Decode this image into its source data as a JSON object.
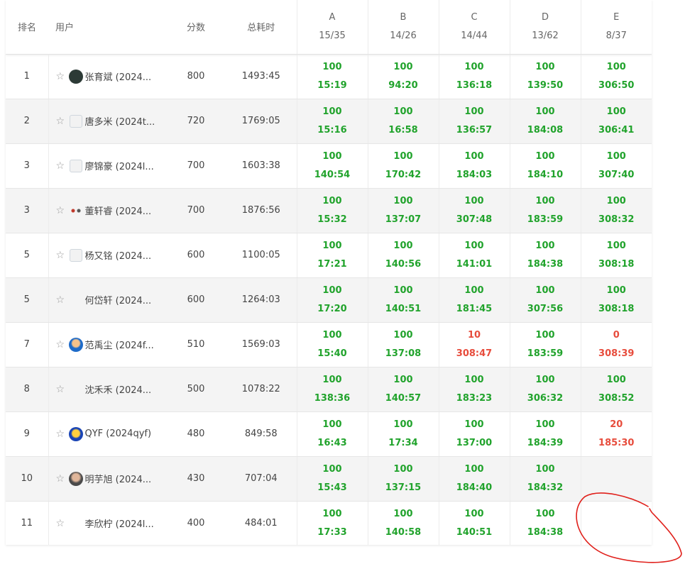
{
  "headers": {
    "rank": "排名",
    "user": "用户",
    "score": "分数",
    "time": "总耗时"
  },
  "problems": [
    {
      "id": "A",
      "stat": "15/35"
    },
    {
      "id": "B",
      "stat": "14/26"
    },
    {
      "id": "C",
      "stat": "14/44"
    },
    {
      "id": "D",
      "stat": "13/62"
    },
    {
      "id": "E",
      "stat": "8/37"
    }
  ],
  "rows": [
    {
      "rank": "1",
      "user": "张育斌 (2024...",
      "avatar": "dark-avatar-icon",
      "score": "800",
      "time": "1493:45",
      "cells": [
        {
          "pts": "100",
          "tm": "15:19",
          "status": "ac"
        },
        {
          "pts": "100",
          "tm": "94:20",
          "status": "ac"
        },
        {
          "pts": "100",
          "tm": "136:18",
          "status": "ac"
        },
        {
          "pts": "100",
          "tm": "139:50",
          "status": "ac"
        },
        {
          "pts": "100",
          "tm": "306:50",
          "status": "ac"
        }
      ]
    },
    {
      "rank": "2",
      "user": "唐多米 (2024t...",
      "avatar": "broken-image-icon",
      "score": "720",
      "time": "1769:05",
      "cells": [
        {
          "pts": "100",
          "tm": "15:16",
          "status": "ac"
        },
        {
          "pts": "100",
          "tm": "16:58",
          "status": "ac"
        },
        {
          "pts": "100",
          "tm": "136:57",
          "status": "ac"
        },
        {
          "pts": "100",
          "tm": "184:08",
          "status": "ac"
        },
        {
          "pts": "100",
          "tm": "306:41",
          "status": "ac"
        }
      ]
    },
    {
      "rank": "3",
      "user": "廖锦豪 (2024l...",
      "avatar": "broken-image-icon",
      "score": "700",
      "time": "1603:38",
      "cells": [
        {
          "pts": "100",
          "tm": "140:54",
          "status": "ac"
        },
        {
          "pts": "100",
          "tm": "170:42",
          "status": "ac"
        },
        {
          "pts": "100",
          "tm": "184:03",
          "status": "ac"
        },
        {
          "pts": "100",
          "tm": "184:10",
          "status": "ac"
        },
        {
          "pts": "100",
          "tm": "307:40",
          "status": "ac"
        }
      ]
    },
    {
      "rank": "3",
      "user": "董轩睿 (2024...",
      "avatar": "dots-avatar-icon",
      "score": "700",
      "time": "1876:56",
      "cells": [
        {
          "pts": "100",
          "tm": "15:32",
          "status": "ac"
        },
        {
          "pts": "100",
          "tm": "137:07",
          "status": "ac"
        },
        {
          "pts": "100",
          "tm": "307:48",
          "status": "ac"
        },
        {
          "pts": "100",
          "tm": "183:59",
          "status": "ac"
        },
        {
          "pts": "100",
          "tm": "308:32",
          "status": "ac"
        }
      ]
    },
    {
      "rank": "5",
      "user": "杨又铭 (2024...",
      "avatar": "broken-image-icon",
      "score": "600",
      "time": "1100:05",
      "cells": [
        {
          "pts": "100",
          "tm": "17:21",
          "status": "ac"
        },
        {
          "pts": "100",
          "tm": "140:56",
          "status": "ac"
        },
        {
          "pts": "100",
          "tm": "141:01",
          "status": "ac"
        },
        {
          "pts": "100",
          "tm": "184:38",
          "status": "ac"
        },
        {
          "pts": "100",
          "tm": "308:18",
          "status": "ac"
        }
      ]
    },
    {
      "rank": "5",
      "user": "何岱轩 (2024...",
      "avatar": "no-avatar",
      "score": "600",
      "time": "1264:03",
      "cells": [
        {
          "pts": "100",
          "tm": "17:20",
          "status": "ac"
        },
        {
          "pts": "100",
          "tm": "140:51",
          "status": "ac"
        },
        {
          "pts": "100",
          "tm": "181:45",
          "status": "ac"
        },
        {
          "pts": "100",
          "tm": "307:56",
          "status": "ac"
        },
        {
          "pts": "100",
          "tm": "308:18",
          "status": "ac"
        }
      ]
    },
    {
      "rank": "7",
      "user": "范禹尘 (2024f...",
      "avatar": "blue-avatar-icon",
      "score": "510",
      "time": "1569:03",
      "cells": [
        {
          "pts": "100",
          "tm": "15:40",
          "status": "ac"
        },
        {
          "pts": "100",
          "tm": "137:08",
          "status": "ac"
        },
        {
          "pts": "10",
          "tm": "308:47",
          "status": "wa"
        },
        {
          "pts": "100",
          "tm": "183:59",
          "status": "ac"
        },
        {
          "pts": "0",
          "tm": "308:39",
          "status": "wa"
        }
      ]
    },
    {
      "rank": "8",
      "user": "沈禾禾 (2024...",
      "avatar": "no-avatar",
      "score": "500",
      "time": "1078:22",
      "cells": [
        {
          "pts": "100",
          "tm": "138:36",
          "status": "ac"
        },
        {
          "pts": "100",
          "tm": "140:57",
          "status": "ac"
        },
        {
          "pts": "100",
          "tm": "183:23",
          "status": "ac"
        },
        {
          "pts": "100",
          "tm": "306:32",
          "status": "ac"
        },
        {
          "pts": "100",
          "tm": "308:52",
          "status": "ac"
        }
      ]
    },
    {
      "rank": "9",
      "user": "QYF (2024qyf)",
      "avatar": "game-avatar-icon",
      "score": "480",
      "time": "849:58",
      "cells": [
        {
          "pts": "100",
          "tm": "16:43",
          "status": "ac"
        },
        {
          "pts": "100",
          "tm": "17:34",
          "status": "ac"
        },
        {
          "pts": "100",
          "tm": "137:00",
          "status": "ac"
        },
        {
          "pts": "100",
          "tm": "184:39",
          "status": "ac"
        },
        {
          "pts": "20",
          "tm": "185:30",
          "status": "wa"
        }
      ]
    },
    {
      "rank": "10",
      "user": "明芋旭 (2024...",
      "avatar": "photo-avatar-icon",
      "score": "430",
      "time": "707:04",
      "cells": [
        {
          "pts": "100",
          "tm": "15:43",
          "status": "ac"
        },
        {
          "pts": "100",
          "tm": "137:15",
          "status": "ac"
        },
        {
          "pts": "100",
          "tm": "184:40",
          "status": "ac"
        },
        {
          "pts": "100",
          "tm": "184:32",
          "status": "ac"
        },
        {
          "pts": "",
          "tm": "",
          "status": "none"
        }
      ]
    },
    {
      "rank": "11",
      "user": "李欣柠 (2024l...",
      "avatar": "no-avatar",
      "score": "400",
      "time": "484:01",
      "cells": [
        {
          "pts": "100",
          "tm": "17:33",
          "status": "ac"
        },
        {
          "pts": "100",
          "tm": "140:58",
          "status": "ac"
        },
        {
          "pts": "100",
          "tm": "140:51",
          "status": "ac"
        },
        {
          "pts": "100",
          "tm": "184:38",
          "status": "ac"
        },
        {
          "pts": "",
          "tm": "",
          "status": "none"
        }
      ]
    }
  ],
  "colors": {
    "accepted": "#21a32c",
    "partial": "#e74c3c",
    "annotation": "#e0201b"
  },
  "icons": {
    "favorite": "☆"
  }
}
